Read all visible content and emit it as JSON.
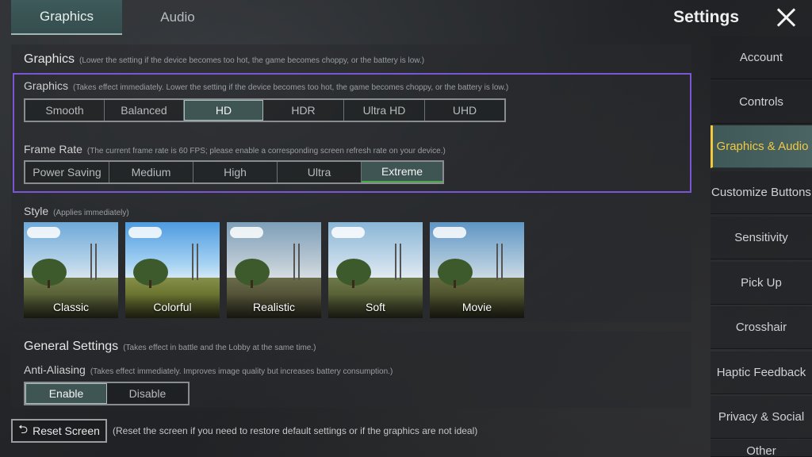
{
  "top_tabs": [
    {
      "label": "Graphics",
      "active": true
    },
    {
      "label": "Audio",
      "active": false
    }
  ],
  "header": {
    "title": "Settings",
    "close_icon": "close-icon"
  },
  "graphics_section": {
    "title": "Graphics",
    "note": "(Lower the setting if the device becomes too hot, the game becomes choppy, or the battery is low.)",
    "graphics_label": "Graphics",
    "graphics_note": "(Takes effect immediately. Lower the setting if the device becomes too hot, the game becomes choppy, or the battery is low.)",
    "graphics_options": [
      "Smooth",
      "Balanced",
      "HD",
      "HDR",
      "Ultra HD",
      "UHD"
    ],
    "graphics_selected": "HD",
    "frame_rate_label": "Frame Rate",
    "frame_rate_note": "(The current frame rate is 60 FPS; please enable a corresponding screen refresh rate on your device.)",
    "frame_rate_options": [
      "Power Saving",
      "Medium",
      "High",
      "Ultra",
      "Extreme"
    ],
    "frame_rate_selected": "Extreme"
  },
  "style_section": {
    "label": "Style",
    "note": "(Applies immediately)",
    "options": [
      "Classic",
      "Colorful",
      "Realistic",
      "Soft",
      "Movie"
    ],
    "selected": "Classic"
  },
  "general_section": {
    "title": "General Settings",
    "note": "(Takes effect in battle and the Lobby at the same time.)",
    "aa_label": "Anti-Aliasing",
    "aa_note": "(Takes effect immediately. Improves image quality but increases battery consumption.)",
    "aa_options": [
      "Enable",
      "Disable"
    ],
    "aa_selected": "Enable"
  },
  "reset": {
    "label": "Reset Screen",
    "note": "(Reset the screen if you need to restore default settings or if the graphics are not ideal)"
  },
  "sidebar": {
    "items": [
      "Account",
      "Controls",
      "Graphics & Audio",
      "Customize Buttons",
      "Sensitivity",
      "Pick Up",
      "Crosshair",
      "Haptic Feedback",
      "Privacy & Social",
      "Other"
    ],
    "active": "Graphics & Audio"
  },
  "colors": {
    "accent_purple": "#7a55d6",
    "selected_yellow": "#f3c93f",
    "teal": "#3e5553",
    "green": "#4ca94a"
  }
}
